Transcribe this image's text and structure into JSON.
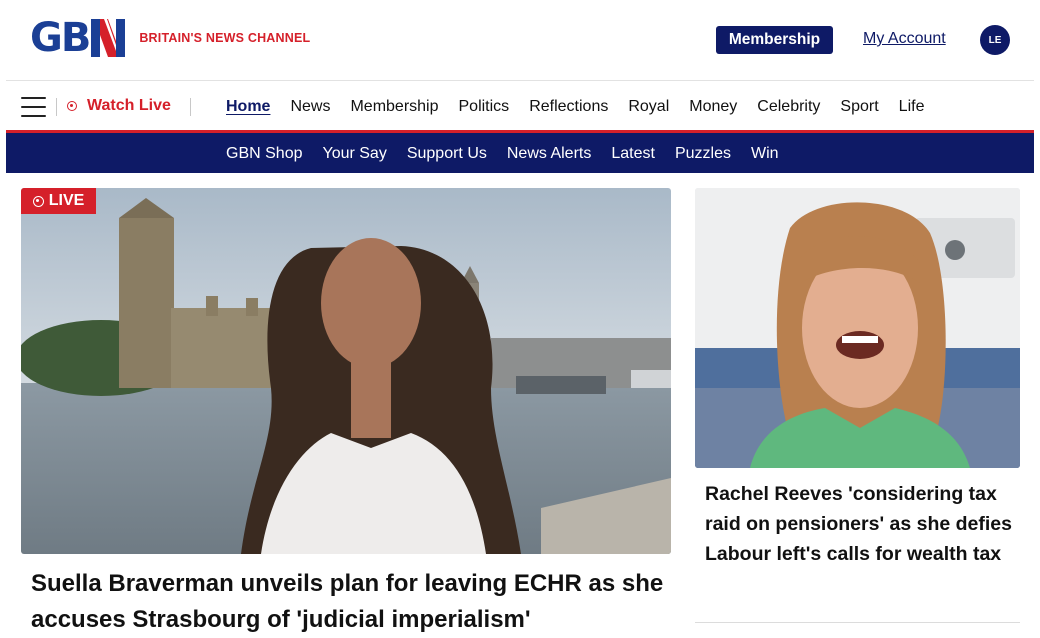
{
  "header": {
    "logo_text": "GBN",
    "tagline": "BRITAIN'S NEWS CHANNEL",
    "membership_label": "Membership",
    "my_account_label": "My Account",
    "avatar_initials": "LE"
  },
  "primary_nav": {
    "watch_live_label": "Watch Live",
    "items": [
      "Home",
      "News",
      "Membership",
      "Politics",
      "Reflections",
      "Royal",
      "Money",
      "Celebrity",
      "Sport",
      "Life"
    ],
    "active": "Home"
  },
  "secondary_nav": {
    "items": [
      "GBN Shop",
      "Your Say",
      "Support Us",
      "News Alerts",
      "Latest",
      "Puzzles",
      "Win"
    ]
  },
  "main_story": {
    "badge": "LIVE",
    "headline": "Suella Braverman unveils plan for leaving ECHR as she accuses Strasbourg of 'judicial imperialism'"
  },
  "side_story": {
    "headline": "Rachel Reeves 'considering tax raid on pensioners' as she defies Labour left's calls for wealth tax"
  },
  "colors": {
    "brand_navy": "#0e1a66",
    "brand_blue": "#1b3f95",
    "brand_red": "#d5202a"
  }
}
